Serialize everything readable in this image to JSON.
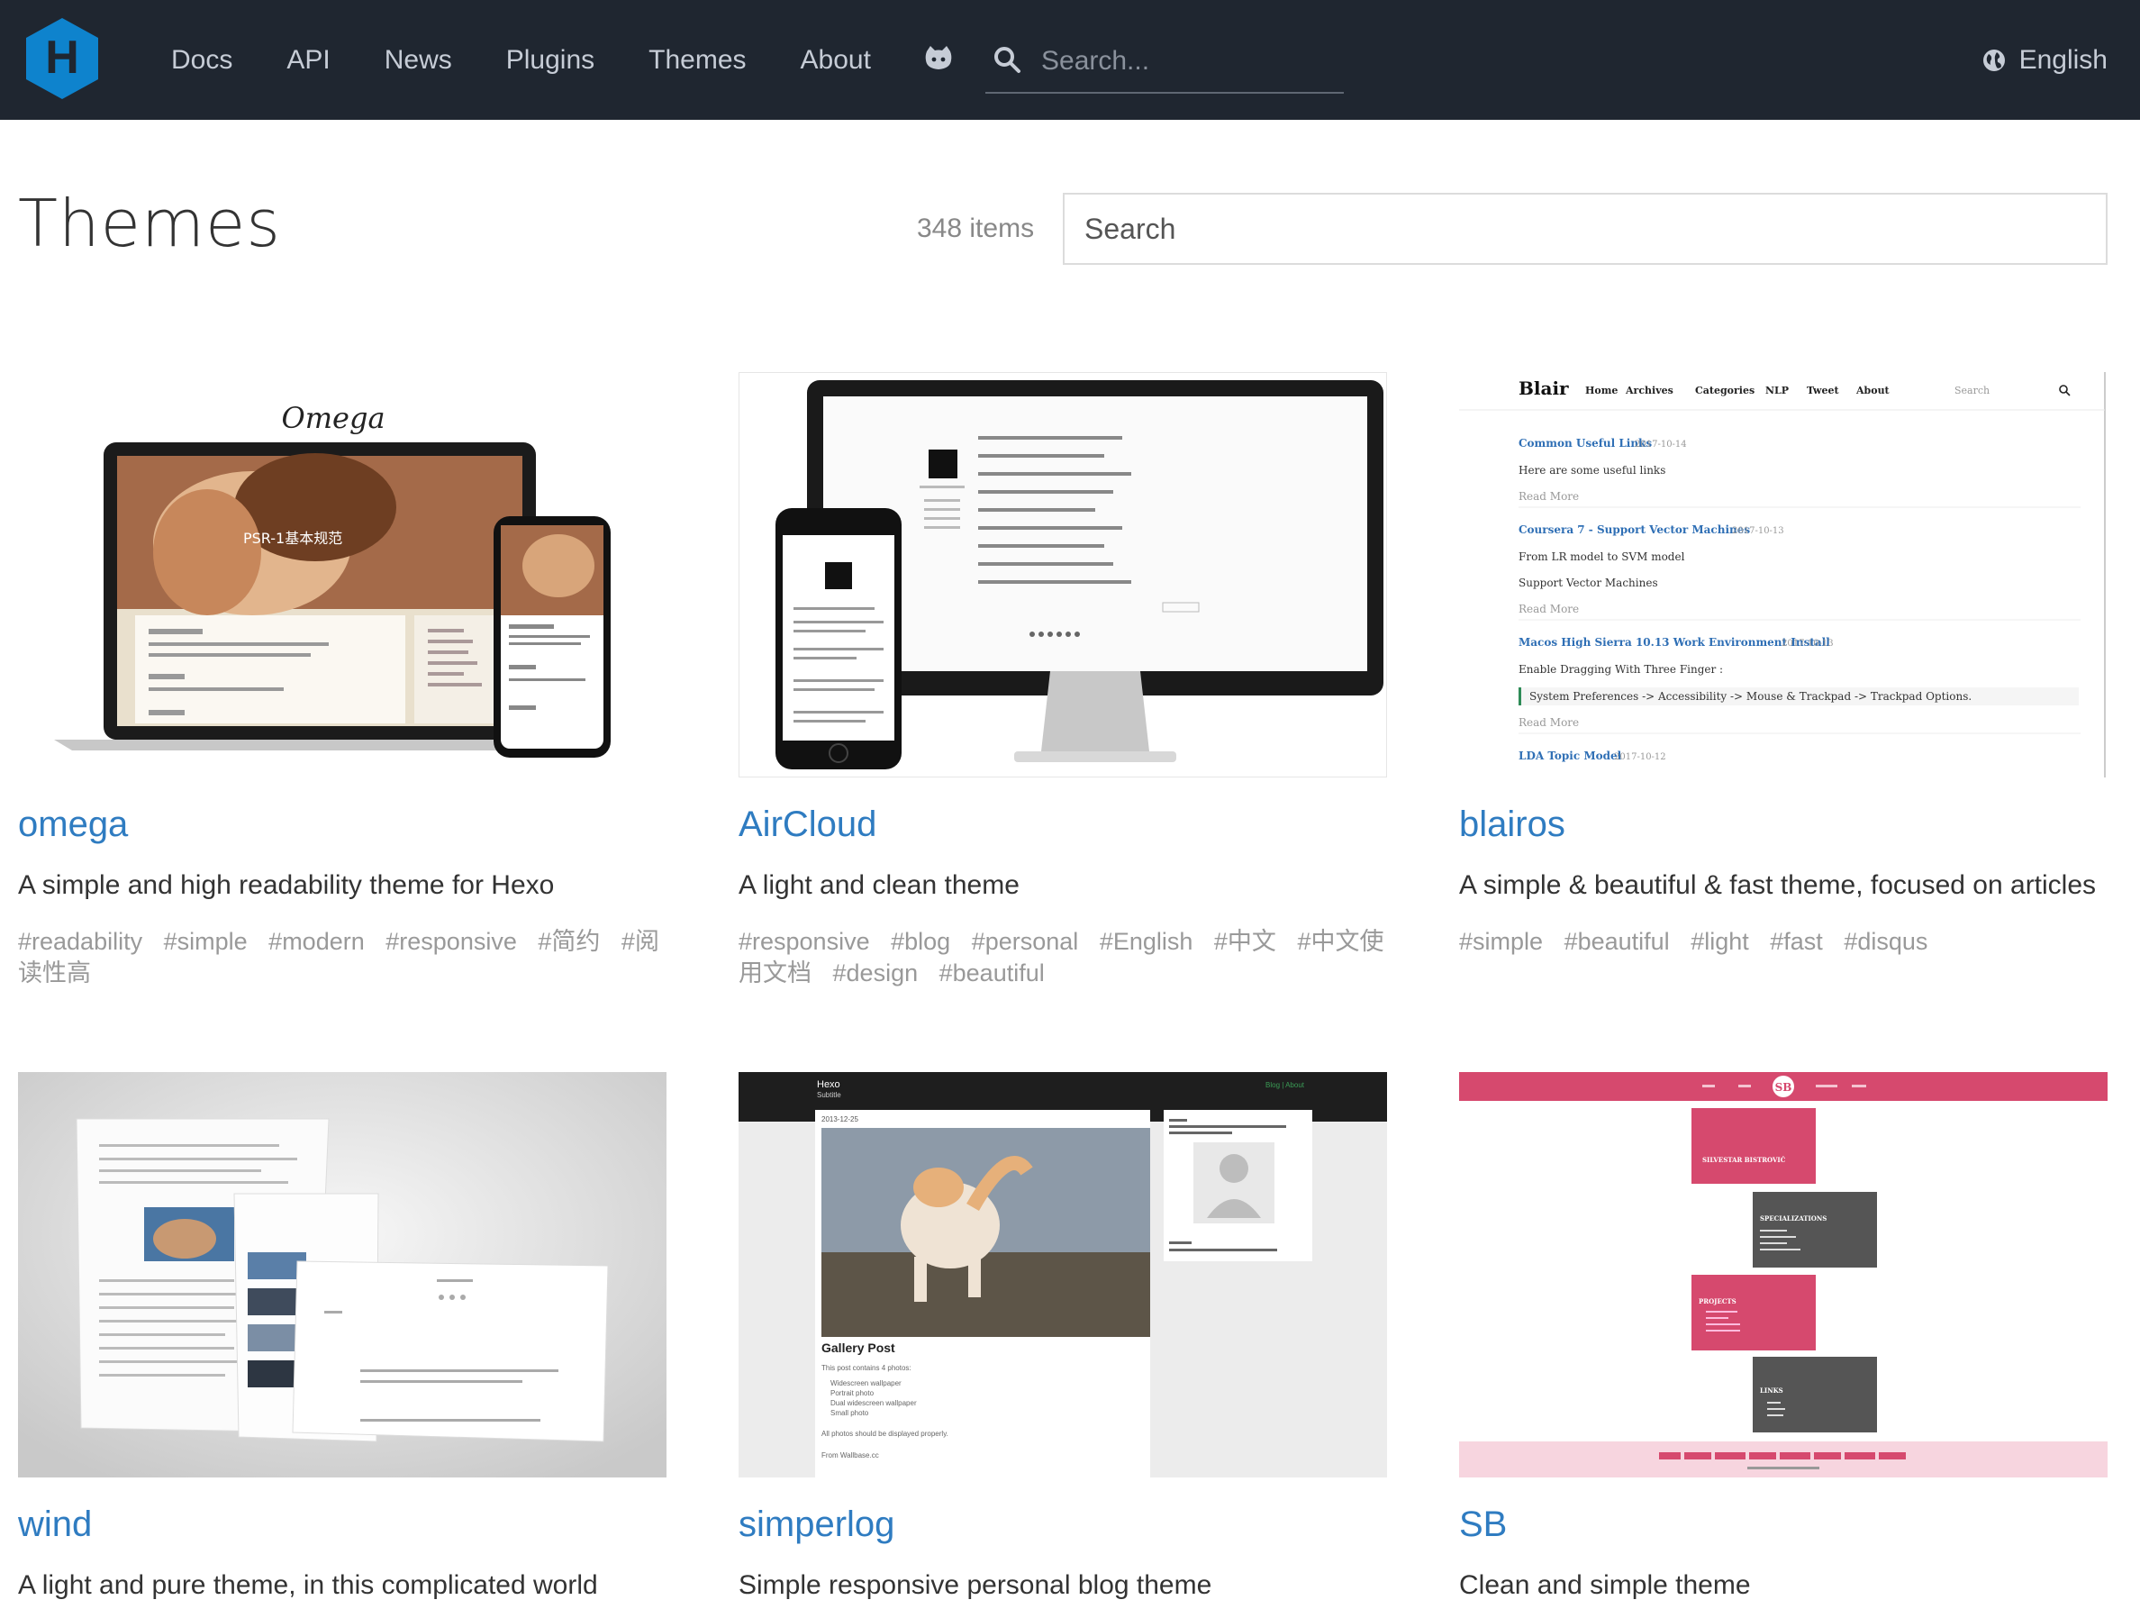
{
  "header": {
    "logo_letter": "H",
    "nav": [
      "Docs",
      "API",
      "News",
      "Plugins",
      "Themes",
      "About"
    ],
    "search_placeholder": "Search...",
    "language": "English",
    "github_icon": "github-icon"
  },
  "page": {
    "title": "Themes",
    "count": "348 items",
    "filter_placeholder": "Search"
  },
  "themes": [
    {
      "name": "omega",
      "description": "A simple and high readability theme for Hexo",
      "tags": [
        "#readability",
        "#simple",
        "#modern",
        "#responsive",
        "#简约",
        "#阅读性高"
      ],
      "preview_title": "Omega",
      "preview_heading": "PSR-1基本规范"
    },
    {
      "name": "AirCloud",
      "description": "A light and clean theme",
      "tags": [
        "#responsive",
        "#blog",
        "#personal",
        "#English",
        "#中文",
        "#中文使用文档",
        "#design",
        "#beautiful"
      ]
    },
    {
      "name": "blairos",
      "description": "A simple & beautiful & fast theme, focused on articles",
      "tags": [
        "#simple",
        "#beautiful",
        "#light",
        "#fast",
        "#disqus"
      ],
      "preview_brand": "Blair",
      "preview_nav": [
        "Home",
        "Archives",
        "Categories",
        "NLP",
        "Tweet",
        "About"
      ],
      "preview_search": "Search",
      "preview_posts": [
        {
          "title": "Common Useful Links",
          "date": "2017-10-14",
          "lines": [
            "Here are some useful links"
          ],
          "more": "Read More"
        },
        {
          "title": "Coursera 7 - Support Vector Machines",
          "date": "2017-10-13",
          "lines": [
            "From LR model to SVM model",
            "Support Vector Machines"
          ],
          "more": "Read More"
        },
        {
          "title": "Macos High Sierra 10.13 Work Environment Install",
          "date": "2017-10-13",
          "lines": [
            "Enable Dragging With Three Finger :"
          ],
          "quote": "System Preferences -> Accessibility -> Mouse & Trackpad -> Trackpad Options.",
          "more": "Read More"
        },
        {
          "title": "LDA Topic Model",
          "date": "2017-10-12",
          "lines": []
        }
      ]
    },
    {
      "name": "wind",
      "description": "A light and pure theme, in this complicated world",
      "tags": []
    },
    {
      "name": "simperlog",
      "description": "Simple responsive personal blog theme",
      "tags": [],
      "preview_brand": "Hexo",
      "preview_sub": "Subtitle",
      "preview_links": "Blog | About",
      "preview_post_title": "Gallery Post",
      "preview_date": "2013-12-25",
      "preview_lines": [
        "This post contains 4 photos:",
        "Widescreen wallpaper",
        "Portrait photo",
        "Dual widescreen wallpaper",
        "Small photo",
        "All photos should be displayed properly.",
        "From Wallbase.cc"
      ]
    },
    {
      "name": "SB",
      "description": "Clean and simple theme",
      "tags": [],
      "preview_logo": "SB",
      "preview_boxes": [
        "SILVESTAR BISTROVIĆ",
        "SPECIALIZATIONS",
        "PROJECTS",
        "LINKS"
      ]
    }
  ],
  "colors": {
    "header_bg": "#1f2630",
    "link": "#2f7cc1",
    "logo": "#0e83cd",
    "sb_pink": "#d6496e"
  }
}
